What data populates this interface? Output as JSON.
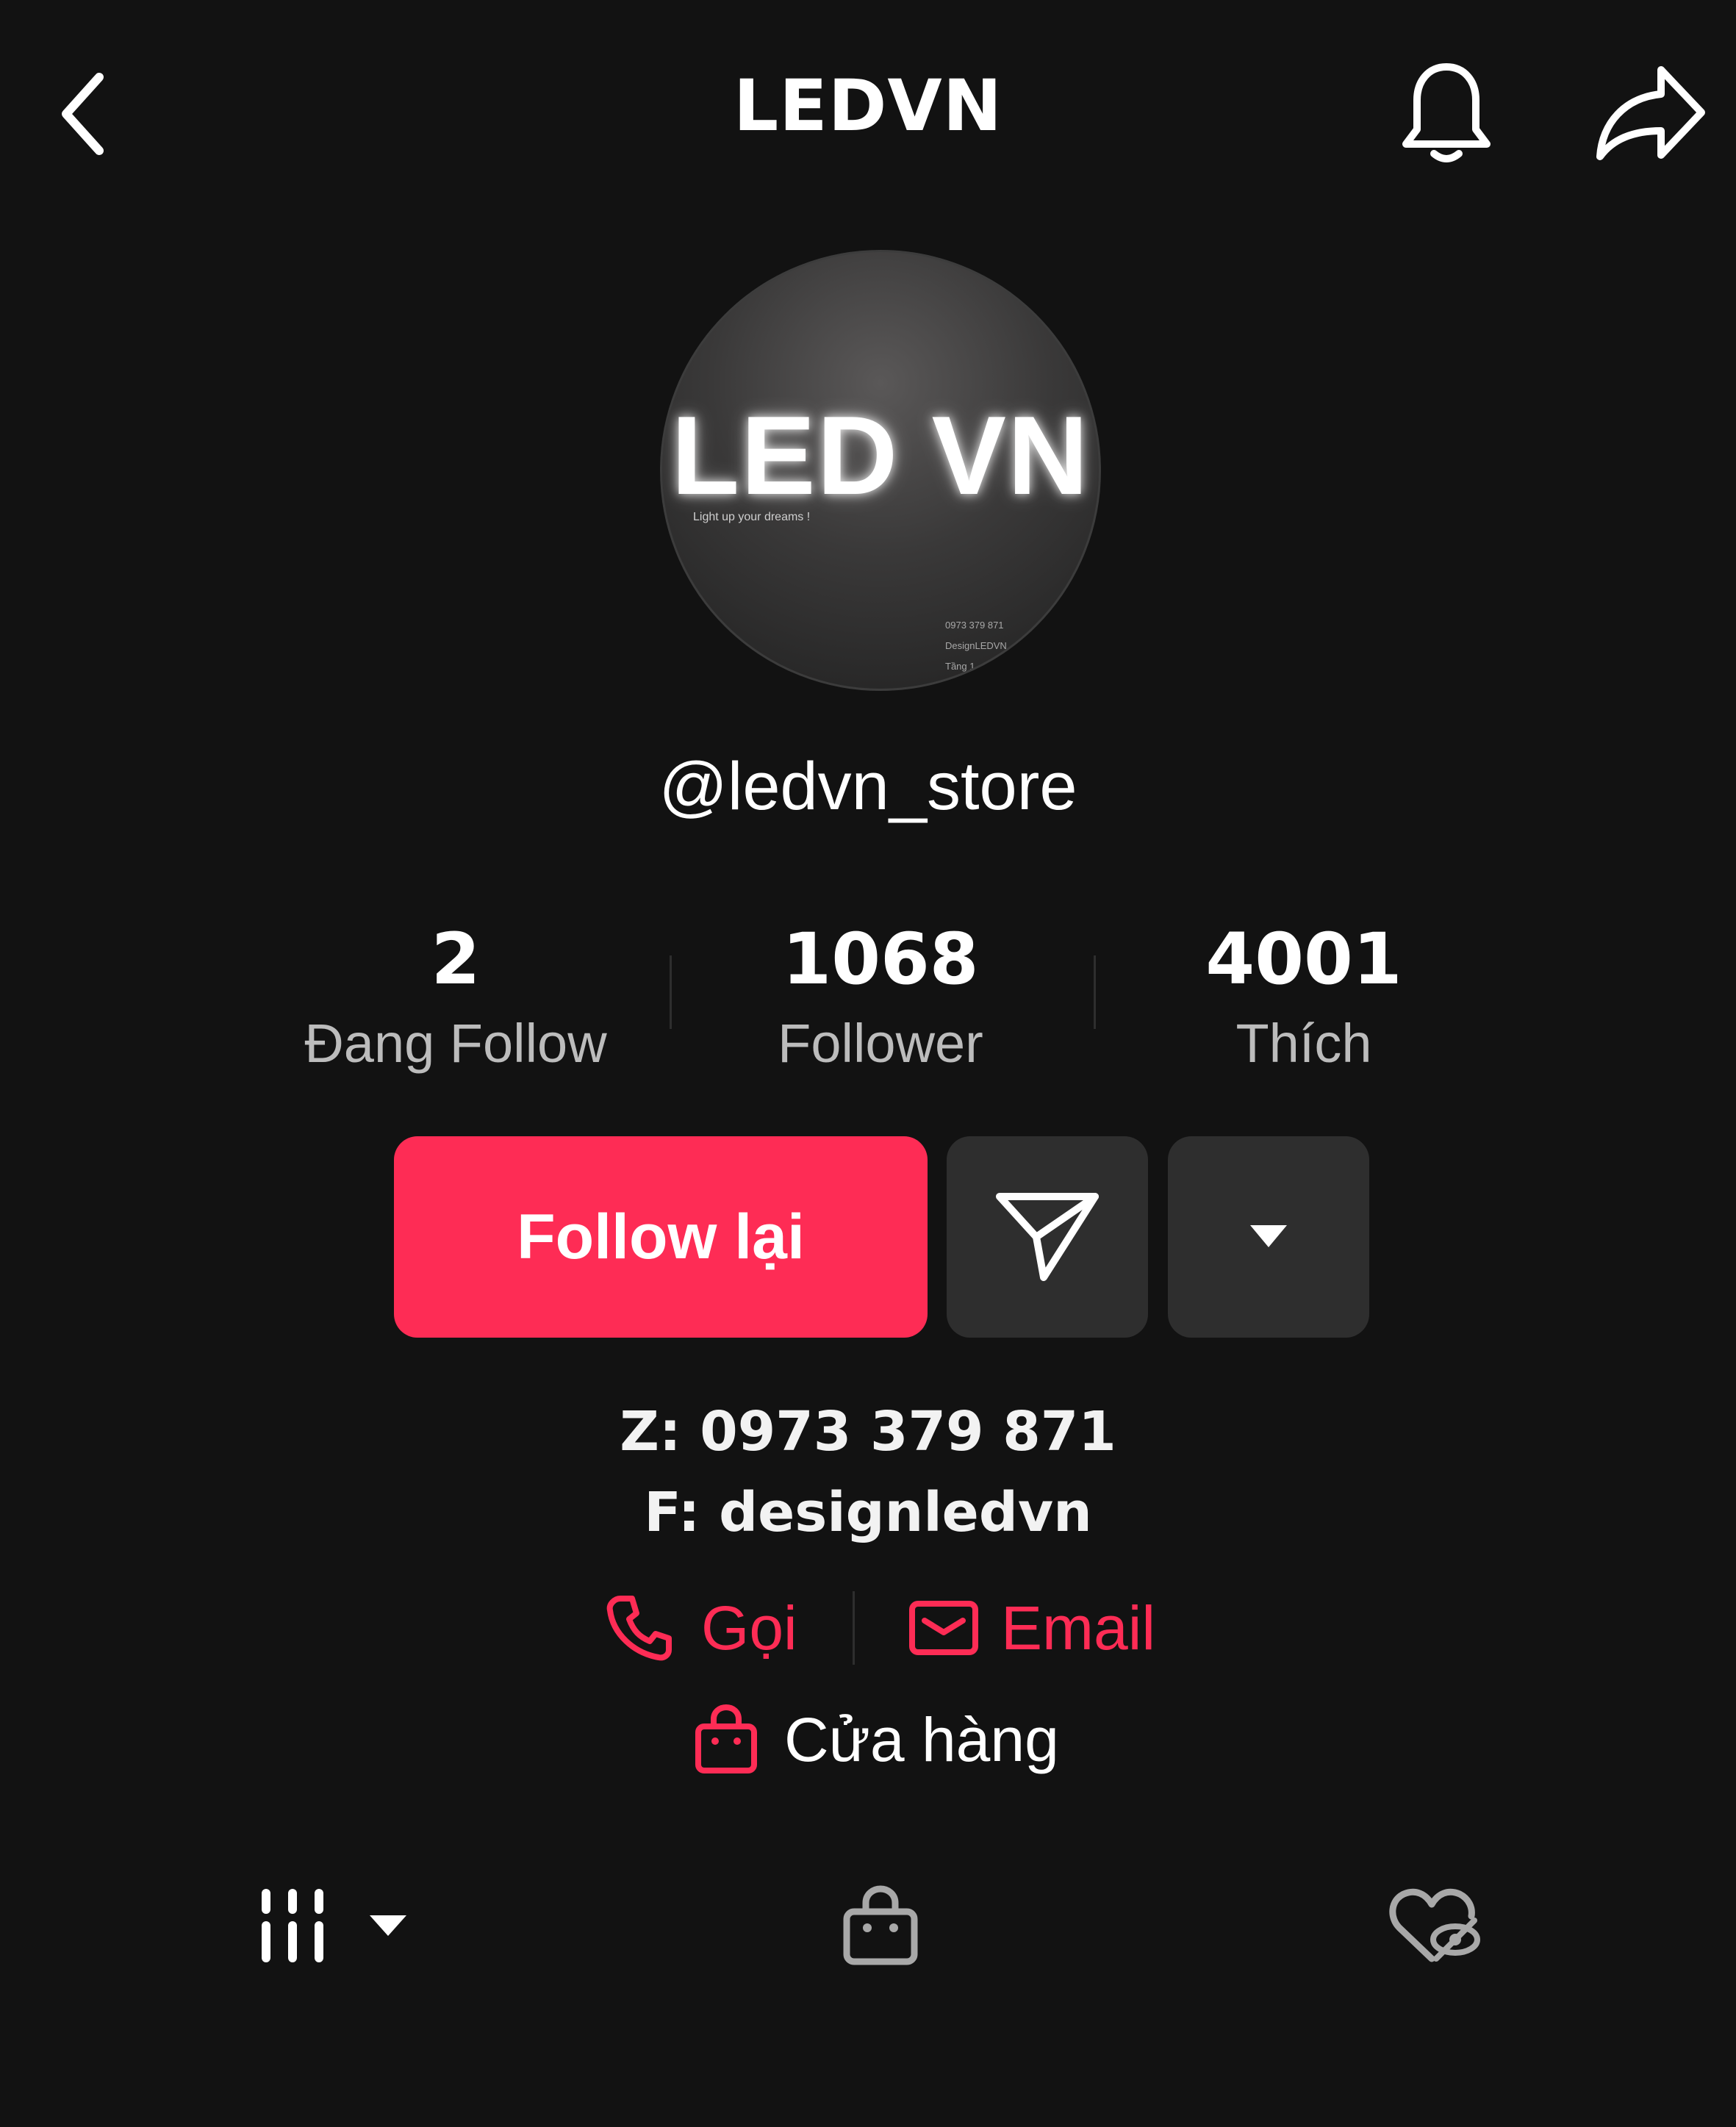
{
  "header": {
    "title": "LEDVN",
    "back_icon": "chevron-left-icon",
    "bell_icon": "bell-icon",
    "share_icon": "share-arrow-icon"
  },
  "avatar": {
    "logo_text": "LED VN",
    "tagline": "Light up your dreams !",
    "small_lines": [
      "0973 379 871",
      "DesignLEDVN",
      "Tầng 1"
    ]
  },
  "profile": {
    "handle": "@ledvn_store"
  },
  "stats": [
    {
      "value": "2",
      "label": "Đang Follow"
    },
    {
      "value": "1068",
      "label": "Follower"
    },
    {
      "value": "4001",
      "label": "Thích"
    }
  ],
  "actions": {
    "follow_label": "Follow lại",
    "message_icon": "send-icon",
    "more_icon": "caret-down-icon"
  },
  "bio": {
    "line1": "Z: 0973 379 871",
    "line2": "F: designledvn"
  },
  "contact": {
    "call_label": "Gọi",
    "email_label": "Email",
    "shop_label": "Cửa hàng"
  },
  "tabs": {
    "videos_icon": "grid-icon",
    "shop_icon": "shopping-bag-icon",
    "liked_icon": "hidden-heart-icon"
  },
  "colors": {
    "background": "#121212",
    "accent": "#fe2c55",
    "secondary_button": "#2e2e2e",
    "muted_text": "#bcbcbc"
  }
}
